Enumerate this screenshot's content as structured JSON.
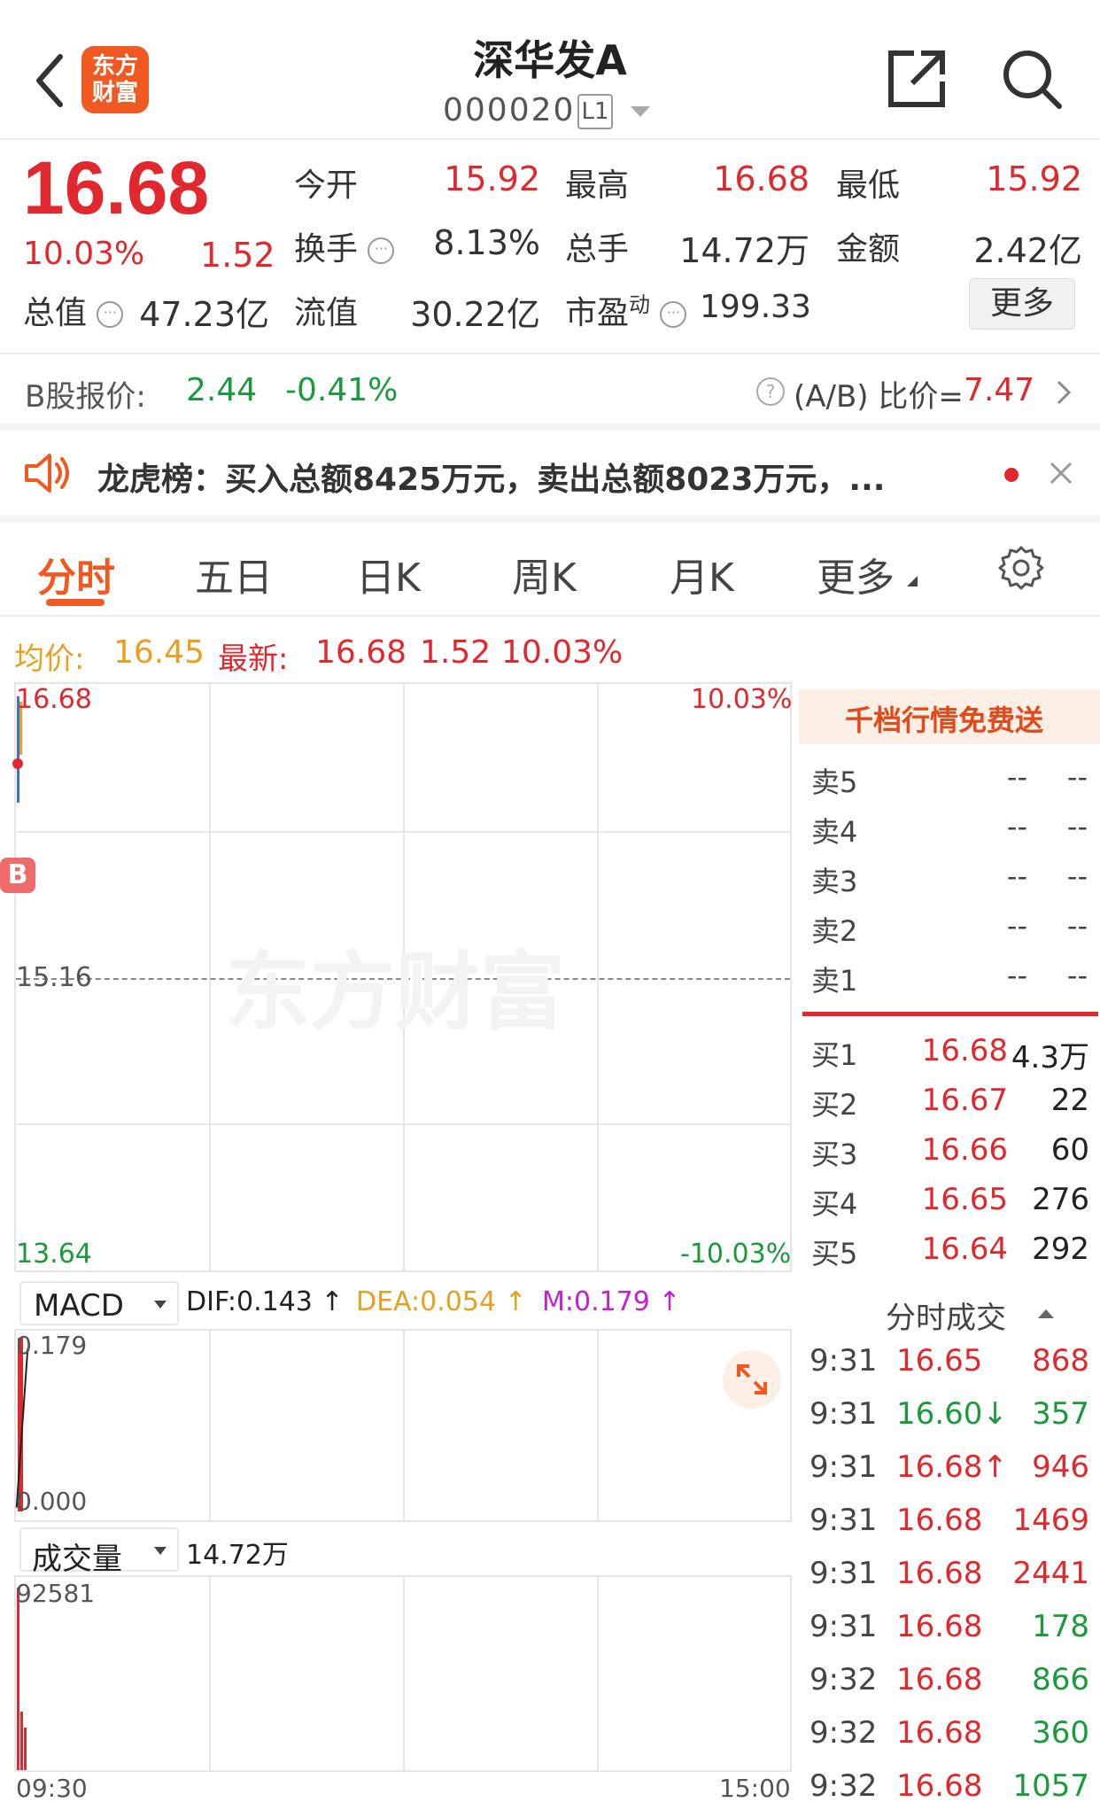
{
  "header": {
    "title": "深华发A",
    "code": "000020",
    "level_badge": "L1",
    "logo_text": "东方财富",
    "back_icon": "chevron-left-icon",
    "share_icon": "share-icon",
    "search_icon": "search-icon"
  },
  "quote": {
    "price": "16.68",
    "change_pct": "10.03%",
    "change_amt": "1.52",
    "open_label": "今开",
    "open_val": "15.92",
    "high_label": "最高",
    "high_val": "16.68",
    "low_label": "最低",
    "low_val": "15.92",
    "turnover_label": "换手",
    "turnover_val": "8.13%",
    "volume_label": "总手",
    "volume_val": "14.72万",
    "amount_label": "金额",
    "amount_val": "2.42亿",
    "mktcap_label": "总值",
    "mktcap_val": "47.23亿",
    "float_label": "流值",
    "float_val": "30.22亿",
    "pe_label": "市盈",
    "pe_sup": "动",
    "pe_val": "199.33",
    "more_label": "更多"
  },
  "bshare": {
    "label": "B股报价:",
    "price": "2.44",
    "change": "-0.41%",
    "ratio_label": "(A/B) 比价=",
    "ratio_val": "7.47"
  },
  "notice": {
    "text": "龙虎榜：买入总额8425万元，卖出总额8023万元，..."
  },
  "tabs": [
    "分时",
    "五日",
    "日K",
    "周K",
    "月K",
    "更多"
  ],
  "summary": {
    "avg_label": "均价:",
    "avg_val": "16.45",
    "latest_label": "最新:",
    "latest_val": "16.68",
    "latest_chg": "1.52",
    "latest_pct": "10.03%"
  },
  "chart": {
    "top_price": "16.68",
    "top_pct": "10.03%",
    "mid_price": "15.16",
    "bottom_price": "13.64",
    "bottom_pct": "-10.03%",
    "watermark": "东方财富",
    "b_marker": "B"
  },
  "macd": {
    "selector": "MACD",
    "dif": "DIF:0.143 ↑",
    "dea": "DEA:0.054 ↑",
    "m": "M:0.179 ↑",
    "top": "0.179",
    "bottom": "0.000"
  },
  "volume": {
    "selector": "成交量",
    "total": "14.72万",
    "top": "92581",
    "time_start": "09:30",
    "time_end": "15:00"
  },
  "orderbook": {
    "banner": "千档行情免费送",
    "asks": [
      {
        "label": "卖5",
        "price": "--",
        "vol": "--"
      },
      {
        "label": "卖4",
        "price": "--",
        "vol": "--"
      },
      {
        "label": "卖3",
        "price": "--",
        "vol": "--"
      },
      {
        "label": "卖2",
        "price": "--",
        "vol": "--"
      },
      {
        "label": "卖1",
        "price": "--",
        "vol": "--"
      }
    ],
    "bids": [
      {
        "label": "买1",
        "price": "16.68",
        "vol": "4.3万"
      },
      {
        "label": "买2",
        "price": "16.67",
        "vol": "22"
      },
      {
        "label": "买3",
        "price": "16.66",
        "vol": "60"
      },
      {
        "label": "买4",
        "price": "16.65",
        "vol": "276"
      },
      {
        "label": "买5",
        "price": "16.64",
        "vol": "292"
      }
    ],
    "ticks_label": "分时成交",
    "ticks": [
      {
        "time": "9:31",
        "price": "16.65",
        "vol": "868",
        "dir": "buy"
      },
      {
        "time": "9:31",
        "price": "16.60↓",
        "vol": "357",
        "dir": "sell"
      },
      {
        "time": "9:31",
        "price": "16.68↑",
        "vol": "946",
        "dir": "buy"
      },
      {
        "time": "9:31",
        "price": "16.68",
        "vol": "1469",
        "dir": "buy"
      },
      {
        "time": "9:31",
        "price": "16.68",
        "vol": "2441",
        "dir": "buy"
      },
      {
        "time": "9:31",
        "price": "16.68",
        "vol": "178",
        "dir": "sell"
      },
      {
        "time": "9:32",
        "price": "16.68",
        "vol": "866",
        "dir": "sell"
      },
      {
        "time": "9:32",
        "price": "16.68",
        "vol": "360",
        "dir": "sell"
      },
      {
        "time": "9:32",
        "price": "16.68",
        "vol": "1057",
        "dir": "sell"
      }
    ]
  }
}
